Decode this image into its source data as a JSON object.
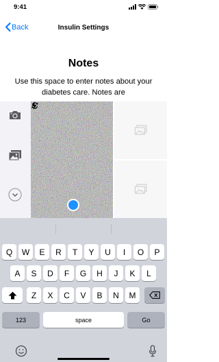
{
  "status_bar": {
    "time": "9:41"
  },
  "nav": {
    "back_label": "Back",
    "title": "Insulin Settings"
  },
  "main": {
    "title": "Notes",
    "description": "Use this space to enter notes about your diabetes care. Notes are"
  },
  "picker": {
    "side_icons": [
      "camera-icon",
      "photo-library-icon",
      "chevron-down-icon"
    ],
    "camera_icons": [
      "camera-flip-icon",
      "flash-icon"
    ],
    "shutter_color": "#1e90ff",
    "thumbnails": [
      "image-placeholder-icon",
      "image-placeholder-icon"
    ]
  },
  "keyboard": {
    "row1": [
      "Q",
      "W",
      "E",
      "R",
      "T",
      "Y",
      "U",
      "I",
      "O",
      "P"
    ],
    "row2": [
      "A",
      "S",
      "D",
      "F",
      "G",
      "H",
      "J",
      "K",
      "L"
    ],
    "row3": [
      "Z",
      "X",
      "C",
      "V",
      "B",
      "N",
      "M"
    ],
    "numbers_label": "123",
    "space_label": "space",
    "go_label": "Go",
    "icons": [
      "shift-icon",
      "delete-icon",
      "emoji-icon",
      "microphone-icon"
    ]
  },
  "colors": {
    "accent": "#007aff",
    "keyboard_bg": "#d1d4db",
    "function_key": "#adb1bb"
  }
}
